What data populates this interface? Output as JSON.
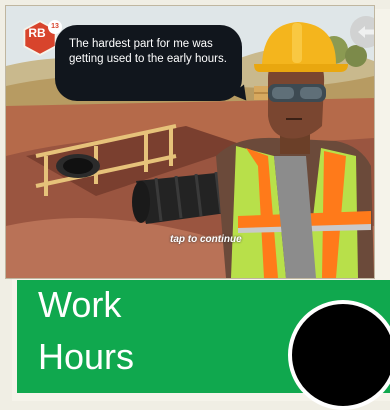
{
  "badge": {
    "initials": "RB",
    "count": "13",
    "color": "#d8442c"
  },
  "dialog": {
    "text": "The hardest part for me was getting used to the early hours."
  },
  "prompt": {
    "tap": "tap to continue"
  },
  "title": {
    "line1": "Work",
    "line2": "Hours",
    "color": "#10a84e"
  },
  "icons": {
    "back": "back-arrow-icon"
  }
}
